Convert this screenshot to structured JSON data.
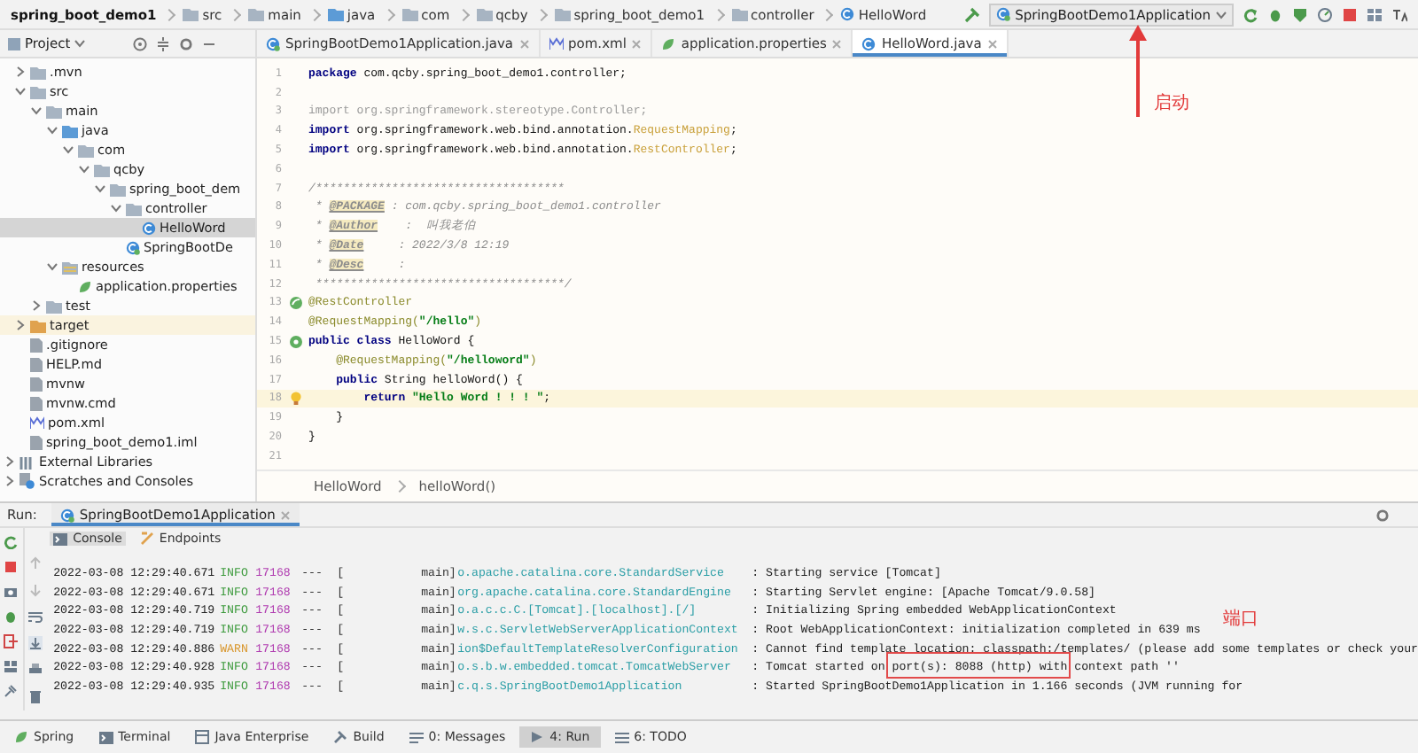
{
  "breadcrumb": [
    {
      "label": "spring_boot_demo1",
      "kind": "project"
    },
    {
      "label": "src",
      "kind": "folder"
    },
    {
      "label": "main",
      "kind": "folder"
    },
    {
      "label": "java",
      "kind": "source"
    },
    {
      "label": "com",
      "kind": "folder"
    },
    {
      "label": "qcby",
      "kind": "folder"
    },
    {
      "label": "spring_boot_demo1",
      "kind": "folder"
    },
    {
      "label": "controller",
      "kind": "folder"
    },
    {
      "label": "HelloWord",
      "kind": "class"
    }
  ],
  "run_config": {
    "label": "SpringBootDemo1Application"
  },
  "project_panel": {
    "title": "Project"
  },
  "tabs": [
    {
      "label": "SpringBootDemo1Application.java",
      "kind": "app-class",
      "selected": false
    },
    {
      "label": "pom.xml",
      "kind": "maven",
      "selected": false
    },
    {
      "label": "application.properties",
      "kind": "properties",
      "selected": false
    },
    {
      "label": "HelloWord.java",
      "kind": "class",
      "selected": true
    }
  ],
  "tree": [
    {
      "label": ".mvn",
      "kind": "folder",
      "expanded": false,
      "selected": false
    },
    {
      "label": "src",
      "kind": "folder",
      "expanded": true,
      "selected": false,
      "children": [
        {
          "label": "main",
          "kind": "folder",
          "expanded": true,
          "selected": false,
          "children": [
            {
              "label": "java",
              "kind": "source",
              "expanded": true,
              "selected": false,
              "children": [
                {
                  "label": "com",
                  "kind": "folder",
                  "expanded": true,
                  "selected": false,
                  "children": [
                    {
                      "label": "qcby",
                      "kind": "folder",
                      "expanded": true,
                      "selected": false,
                      "children": [
                        {
                          "label": "spring_boot_dem",
                          "kind": "folder",
                          "expanded": true,
                          "selected": false,
                          "children": [
                            {
                              "label": "controller",
                              "kind": "folder",
                              "expanded": true,
                              "selected": false,
                              "children": [
                                {
                                  "label": "HelloWord",
                                  "kind": "class",
                                  "selected": true
                                }
                              ]
                            },
                            {
                              "label": "SpringBootDe",
                              "kind": "app-class",
                              "selected": false
                            }
                          ]
                        }
                      ]
                    }
                  ]
                }
              ]
            },
            {
              "label": "resources",
              "kind": "resources",
              "expanded": true,
              "selected": false,
              "children": [
                {
                  "label": "application.properties",
                  "kind": "properties",
                  "selected": false
                }
              ]
            }
          ]
        },
        {
          "label": "test",
          "kind": "folder",
          "expanded": false,
          "selected": false
        }
      ]
    },
    {
      "label": "target",
      "kind": "target",
      "expanded": false,
      "selected": false
    },
    {
      "label": ".gitignore",
      "kind": "file",
      "selected": false
    },
    {
      "label": "HELP.md",
      "kind": "file",
      "selected": false
    },
    {
      "label": "mvnw",
      "kind": "file",
      "selected": false
    },
    {
      "label": "mvnw.cmd",
      "kind": "file",
      "selected": false
    },
    {
      "label": "pom.xml",
      "kind": "maven",
      "selected": false
    },
    {
      "label": "spring_boot_demo1.iml",
      "kind": "file",
      "selected": false
    },
    {
      "label": "External Libraries",
      "kind": "library",
      "expanded": false,
      "selected": false,
      "root": true
    },
    {
      "label": "Scratches and Consoles",
      "kind": "scratch",
      "expanded": false,
      "selected": false,
      "root": true
    }
  ],
  "code": [
    {
      "number": "1",
      "segments": [
        {
          "kind": "keyword",
          "text": "package"
        },
        {
          "kind": "plain",
          "text": " com.qcby.spring_boot_demo1.controller;"
        }
      ]
    },
    {
      "number": "2"
    },
    {
      "number": "3",
      "segments": [
        {
          "kind": "unused",
          "text": "import org.springframework.stereotype.Controller;"
        }
      ]
    },
    {
      "number": "4",
      "segments": [
        {
          "kind": "keyword",
          "text": "import"
        },
        {
          "kind": "plain",
          "text": " org.springframework.web.bind.annotation."
        },
        {
          "kind": "classref",
          "text": "RequestMapping"
        },
        {
          "kind": "plain",
          "text": ";"
        }
      ]
    },
    {
      "number": "5",
      "segments": [
        {
          "kind": "keyword",
          "text": "import"
        },
        {
          "kind": "plain",
          "text": " org.springframework.web.bind.annotation."
        },
        {
          "kind": "classref",
          "text": "RestController"
        },
        {
          "kind": "plain",
          "text": ";"
        }
      ]
    },
    {
      "number": "6"
    },
    {
      "number": "7",
      "segments": [
        {
          "kind": "comment",
          "text": "/************************************"
        }
      ]
    },
    {
      "number": "8",
      "segments": [
        {
          "kind": "comment",
          "text": " * "
        },
        {
          "kind": "doctag",
          "text": "@PACKAGE"
        },
        {
          "kind": "comment",
          "text": " : com.qcby.spring_boot_demo1.controller"
        }
      ]
    },
    {
      "number": "9",
      "segments": [
        {
          "kind": "comment",
          "text": " * "
        },
        {
          "kind": "doctag",
          "text": "@Author"
        },
        {
          "kind": "comment",
          "text": "    :  叫我老伯"
        }
      ]
    },
    {
      "number": "10",
      "segments": [
        {
          "kind": "comment",
          "text": " * "
        },
        {
          "kind": "doctag",
          "text": "@Date"
        },
        {
          "kind": "comment",
          "text": "     : 2022/3/8 12:19"
        }
      ]
    },
    {
      "number": "11",
      "segments": [
        {
          "kind": "comment",
          "text": " * "
        },
        {
          "kind": "doctag",
          "text": "@Desc"
        },
        {
          "kind": "comment",
          "text": "     :"
        }
      ]
    },
    {
      "number": "12",
      "segments": [
        {
          "kind": "comment",
          "text": " ************************************/"
        }
      ]
    },
    {
      "number": "13",
      "kind": "bean",
      "segments": [
        {
          "kind": "annotation",
          "text": "@RestController"
        }
      ]
    },
    {
      "number": "14",
      "segments": [
        {
          "kind": "annotation",
          "text": "@RequestMapping("
        },
        {
          "kind": "string",
          "text": "\"/hello\""
        },
        {
          "kind": "annotation",
          "text": ")"
        }
      ]
    },
    {
      "number": "15",
      "kind": "bean-run",
      "segments": [
        {
          "kind": "keyword",
          "text": "public class"
        },
        {
          "kind": "plain",
          "text": " HelloWord {"
        }
      ]
    },
    {
      "number": "16",
      "segments": [
        {
          "kind": "annotation",
          "text": "    @RequestMapping("
        },
        {
          "kind": "string",
          "text": "\"/helloword\""
        },
        {
          "kind": "annotation",
          "text": ")"
        }
      ]
    },
    {
      "number": "17",
      "segments": [
        {
          "kind": "keyword",
          "text": "    public"
        },
        {
          "kind": "plain",
          "text": " String helloWord() {"
        }
      ]
    },
    {
      "number": "18",
      "current": true,
      "kind": "bulb",
      "segments": [
        {
          "kind": "keyword",
          "text": "        return"
        },
        {
          "kind": "string",
          "text": " \"Hello Word ! ! ! \""
        },
        {
          "kind": "plain",
          "text": ";"
        }
      ]
    },
    {
      "number": "19",
      "segments": [
        {
          "kind": "plain",
          "text": "    }"
        }
      ]
    },
    {
      "number": "20",
      "segments": [
        {
          "kind": "plain",
          "text": "}"
        }
      ]
    },
    {
      "number": "21"
    }
  ],
  "editor_breadcrumb": [
    "HelloWord",
    "helloWord()"
  ],
  "run_panel": {
    "title": "Run:",
    "tab": "SpringBootDemo1Application",
    "subtabs": [
      {
        "label": "Console",
        "kind": "console",
        "selected": true
      },
      {
        "label": "Endpoints",
        "kind": "endpoints",
        "selected": false
      }
    ],
    "log": [
      {
        "time": "2022-03-08 12:29:40.671",
        "level": "INFO",
        "kind": "info",
        "pid": "17168",
        "sep": "---",
        "thread": "[           main]",
        "logger": "o.apache.catalina.core.StandardService",
        "message": ": Starting service [Tomcat]"
      },
      {
        "time": "2022-03-08 12:29:40.671",
        "level": "INFO",
        "kind": "info",
        "pid": "17168",
        "sep": "---",
        "thread": "[           main]",
        "logger": "org.apache.catalina.core.StandardEngine",
        "message": ": Starting Servlet engine: [Apache Tomcat/9.0.58]"
      },
      {
        "time": "2022-03-08 12:29:40.719",
        "level": "INFO",
        "kind": "info",
        "pid": "17168",
        "sep": "---",
        "thread": "[           main]",
        "logger": "o.a.c.c.C.[Tomcat].[localhost].[/]",
        "message": ": Initializing Spring embedded WebApplicationContext"
      },
      {
        "time": "2022-03-08 12:29:40.719",
        "level": "INFO",
        "kind": "info",
        "pid": "17168",
        "sep": "---",
        "thread": "[           main]",
        "logger": "w.s.c.ServletWebServerApplicationContext",
        "message": ": Root WebApplicationContext: initialization completed in 639 ms"
      },
      {
        "time": "2022-03-08 12:29:40.886",
        "level": "WARN",
        "kind": "warn",
        "pid": "17168",
        "sep": "---",
        "thread": "[           main]",
        "logger": "ion$DefaultTemplateResolverConfiguration",
        "message": ": Cannot find template location: classpath:/templates/ (please add some templates or check your"
      },
      {
        "time": "2022-03-08 12:29:40.928",
        "level": "INFO",
        "kind": "info",
        "pid": "17168",
        "sep": "---",
        "thread": "[           main]",
        "logger": "o.s.b.w.embedded.tomcat.TomcatWebServer",
        "message": ": Tomcat started on port(s): 8088 (http) with context path ''"
      },
      {
        "time": "2022-03-08 12:29:40.935",
        "level": "INFO",
        "kind": "info",
        "pid": "17168",
        "sep": "---",
        "thread": "[           main]",
        "logger": "c.q.s.SpringBootDemo1Application",
        "message": ": Started SpringBootDemo1Application in 1.166 seconds (JVM running for"
      }
    ]
  },
  "tool_windows": [
    {
      "label": "Spring",
      "kind": "spring",
      "selected": false
    },
    {
      "label": "Terminal",
      "kind": "terminal",
      "selected": false
    },
    {
      "label": "Java Enterprise",
      "kind": "enterprise",
      "selected": false
    },
    {
      "label": "Build",
      "kind": "build",
      "selected": false
    },
    {
      "label": "0: Messages",
      "kind": "messages",
      "selected": false
    },
    {
      "label": "4: Run",
      "kind": "run",
      "selected": true
    },
    {
      "label": "6: TODO",
      "kind": "todo",
      "selected": false
    }
  ],
  "annotations": [
    {
      "kind": "arrow",
      "label": "启动"
    },
    {
      "kind": "box",
      "label": "端口"
    }
  ]
}
